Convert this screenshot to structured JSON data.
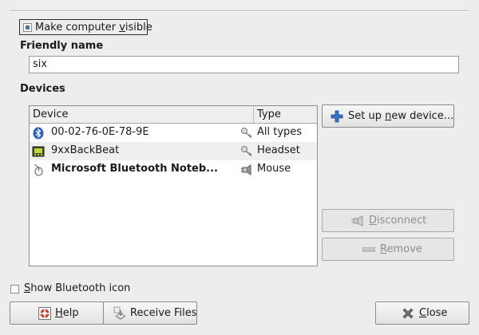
{
  "visibility": {
    "checked": true,
    "label_pre": "Make computer ",
    "label_mnemonic": "v",
    "label_post": "isible"
  },
  "friendly_name": {
    "heading": "Friendly name",
    "value": "six"
  },
  "devices": {
    "heading": "Devices",
    "columns": {
      "device": "Device",
      "type": "Type"
    },
    "rows": [
      {
        "name": "00-02-76-0E-78-9E",
        "type": "All types",
        "icon": "bluetooth-icon",
        "state_icon": "key-icon",
        "bold": false
      },
      {
        "name": "9xxBackBeat",
        "type": "Headset",
        "icon": "headset-icon",
        "state_icon": "key-icon",
        "bold": false
      },
      {
        "name": "Microsoft Bluetooth Noteb...",
        "type": "Mouse",
        "icon": "mouse-icon",
        "state_icon": "plug-connected-icon",
        "bold": true
      }
    ]
  },
  "buttons": {
    "setup": {
      "pre": "Set up ",
      "mnemonic": "n",
      "post": "ew device...",
      "icon": "plus-icon"
    },
    "disconnect": {
      "pre": "",
      "mnemonic": "D",
      "post": "isconnect",
      "icon": "plug-icon",
      "enabled": false
    },
    "remove": {
      "pre": "",
      "mnemonic": "R",
      "post": "emove",
      "icon": "minus-icon",
      "enabled": false
    },
    "help": {
      "pre": "",
      "mnemonic": "H",
      "post": "elp",
      "icon": "help-lifebuoy-icon"
    },
    "receive": {
      "label": "Receive Files",
      "icon": "receive-files-icon"
    },
    "close": {
      "pre": "",
      "mnemonic": "C",
      "post": "lose",
      "icon": "close-x-icon"
    }
  },
  "show_icon": {
    "checked": false,
    "label_pre": "",
    "label_mnemonic": "S",
    "label_post": "how Bluetooth icon"
  },
  "colors": {
    "window_bg": "#ededed",
    "accent_blue": "#3a6fc4",
    "disabled_text": "#8d8d8d"
  }
}
